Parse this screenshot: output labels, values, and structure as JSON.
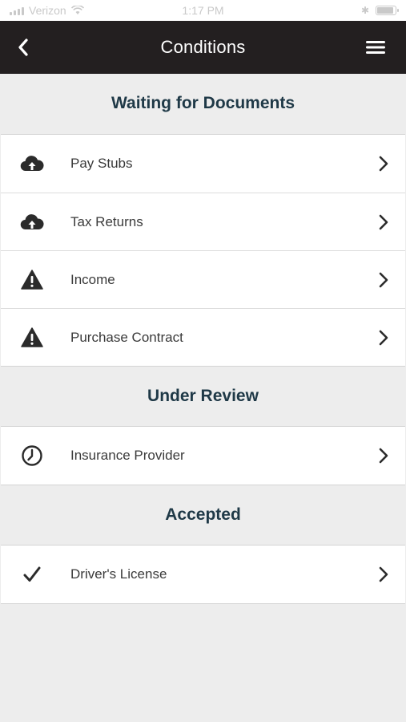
{
  "status_bar": {
    "carrier": "Verizon",
    "time": "1:17 PM",
    "bluetooth": "✱",
    "battery_level": 0.9
  },
  "header": {
    "title": "Conditions",
    "back_icon": "chevron-left-icon",
    "menu_icon": "hamburger-menu-icon",
    "background": "#231f20"
  },
  "sections": [
    {
      "title": "Waiting for Documents",
      "items": [
        {
          "label": "Pay Stubs",
          "icon": "cloud-upload-icon"
        },
        {
          "label": "Tax Returns",
          "icon": "cloud-upload-icon"
        },
        {
          "label": "Income",
          "icon": "warning-icon"
        },
        {
          "label": "Purchase Contract",
          "icon": "warning-icon"
        }
      ]
    },
    {
      "title": "Under Review",
      "items": [
        {
          "label": "Insurance Provider",
          "icon": "clock-icon"
        }
      ]
    },
    {
      "title": "Accepted",
      "items": [
        {
          "label": "Driver's License",
          "icon": "checkmark-icon"
        }
      ]
    }
  ],
  "colors": {
    "section_title": "#1f3947",
    "page_background": "#ededed",
    "row_background": "#ffffff"
  }
}
